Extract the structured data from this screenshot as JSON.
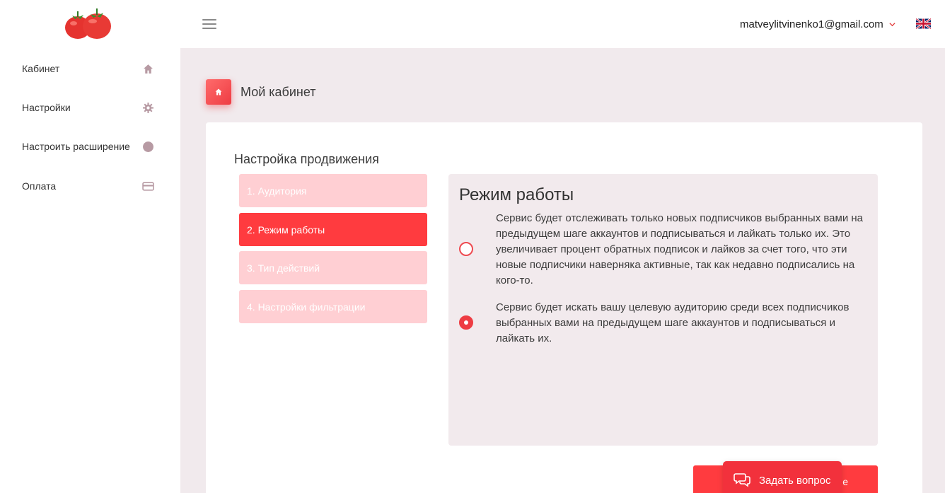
{
  "header": {
    "user_email": "matveylitvinenko1@gmail.com",
    "icons": {
      "logo": "tomatoes-logo",
      "menu": "hamburger-icon",
      "dropdown": "chevron-down-icon",
      "language": "uk-flag-icon"
    }
  },
  "sidebar": {
    "items": [
      {
        "label": "Кабинет",
        "icon": "home-icon"
      },
      {
        "label": "Настройки",
        "icon": "gear-icon"
      },
      {
        "label": "Настроить расширение",
        "icon": "circle-icon"
      },
      {
        "label": "Оплата",
        "icon": "credit-card-icon"
      }
    ]
  },
  "breadcrumb": {
    "title": "Мой кабинет",
    "icon": "home-icon"
  },
  "main": {
    "section_title": "Настройка продвижения",
    "steps": [
      {
        "label": "1. Аудитория",
        "state": "inactive"
      },
      {
        "label": "2. Режим работы",
        "state": "active"
      },
      {
        "label": "3. Тип действий",
        "state": "inactive"
      },
      {
        "label": "4. Настройки фильтрации",
        "state": "inactive"
      }
    ],
    "panel": {
      "title": "Режим работы",
      "options": [
        {
          "text": "Сервис будет отслеживать только новых подписчиков выбранных вами на предыдущем шаге аккаунтов и подписываться и лайкать только их. Это увеличивает процент обратных подписок и лайков за счет того, что эти новые подписчики наверняка активные, так как недавно подписались на кого-то.",
          "selected": false
        },
        {
          "text": "Сервис будет искать вашу целевую аудиторию среди всех подписчиков выбранных вами на предыдущем шаге аккаунтов и подписываться и лайкать их.",
          "selected": true
        }
      ]
    },
    "next_button_label": "е"
  },
  "chat": {
    "label": "Задать вопрос",
    "icon": "chat-bubbles-icon"
  },
  "colors": {
    "accent": "#ff3b3f",
    "accent_light": "#ffcfd3",
    "panel_bg": "#f2eaed",
    "page_bg": "#f1eaed"
  }
}
